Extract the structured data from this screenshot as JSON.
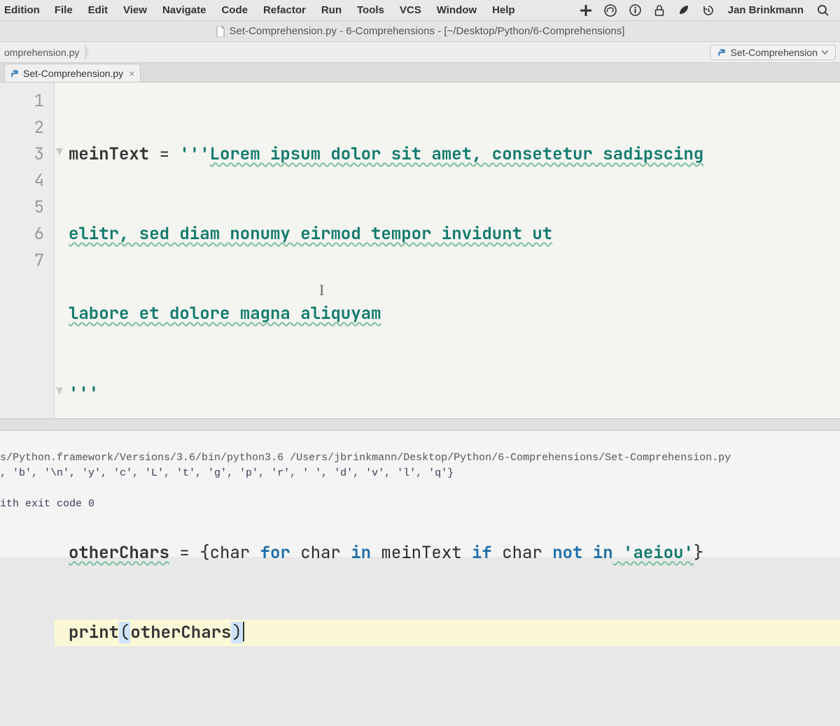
{
  "menubar": {
    "edition": " Edition",
    "items": [
      "File",
      "Edit",
      "View",
      "Navigate",
      "Code",
      "Refactor",
      "Run",
      "Tools",
      "VCS",
      "Window",
      "Help"
    ],
    "user": "Jan Brinkmann"
  },
  "titlebar": {
    "text": "Set-Comprehension.py - 6-Comprehensions - [~/Desktop/Python/6-Comprehensions]"
  },
  "breadcrumb": {
    "crumb0": "omprehension.py"
  },
  "runconfig": {
    "label": "Set-Comprehension"
  },
  "tabs": {
    "file": "Set-Comprehension.py"
  },
  "editor": {
    "gutter": [
      "1",
      "2",
      "3",
      "4",
      "5",
      "6",
      "7"
    ],
    "line1": {
      "var": "meinText",
      "eq": " = ",
      "strOpen": "'''",
      "str": "Lorem ipsum dolor sit amet, consetetur sadipscing"
    },
    "line2": {
      "str": "elitr, sed diam nonumy eirmod tempor invidunt ut"
    },
    "line3": {
      "str": "labore et dolore magna aliquyam"
    },
    "line4": {
      "strClose": "'''"
    },
    "line6": {
      "var": "otherChars",
      "eq": " = {",
      "ident1": "char ",
      "kw1": "for",
      "ident2": " char ",
      "kw2": "in",
      "ident3": " meinText ",
      "kw3": "if",
      "ident4": " char ",
      "kw4": "not in",
      "str": " 'aeiou'",
      "close": "}"
    },
    "line7": {
      "fn": "print",
      "open": "(",
      "arg": "otherChars",
      "close": ")"
    }
  },
  "console": {
    "line1": "s/Python.framework/Versions/3.6/bin/python3.6 /Users/jbrinkmann/Desktop/Python/6-Comprehensions/Set-Comprehension.py",
    "line2": ", 'b', '\\n', 'y', 'c', 'L', 't', 'g', 'p', 'r', ' ', 'd', 'v', 'l', 'q'}",
    "line3": "",
    "line4": "ith exit code 0"
  }
}
